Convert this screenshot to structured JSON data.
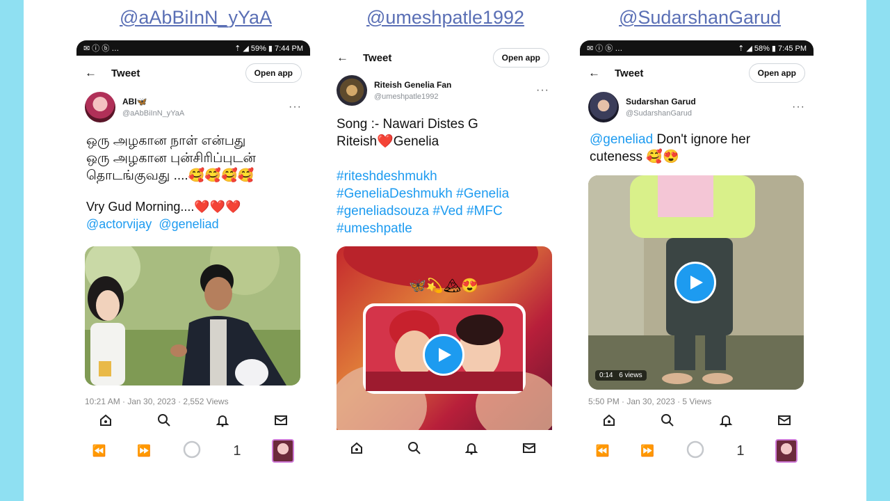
{
  "handles": [
    "@aAbBiInN_yYaA",
    "@umeshpatle1992",
    "@SudarshanGarud"
  ],
  "common": {
    "tweet_title": "Tweet",
    "open_app": "Open app",
    "back_icon": "←",
    "more_icon": "···",
    "tab_count": "1"
  },
  "phone1": {
    "status_left": "✉ ⓘ ⓑ …",
    "status_right": "⇡ ◢ 59% ▮ 7:44 PM",
    "author_name": "ABI🦋",
    "author_handle": "@aAbBiInN_yYaA",
    "line1": "ஒரு அழகான நாள் என்பது",
    "line2": "ஒரு அழகான புன்சிரிப்புடன்",
    "line3": "தொடங்குவது ....🥰🥰🥰🥰",
    "line4": " Vry Gud Morning....❤️❤️❤️",
    "mention1": "@actorvijay",
    "mention2": "@geneliad",
    "timestamp": "10:21 AM · Jan 30, 2023 · 2,552 Views"
  },
  "phone2": {
    "author_name": "Riteish Genelia Fan",
    "author_handle": "@umeshpatle1992",
    "line1": "Song :- Nawari Distes G",
    "line2": "Riteish❤️Genelia",
    "hashtags1": "#riteshdeshmukh",
    "hashtags2": "#GeneliaDeshmukh #Genelia",
    "hashtags3": "#geneliadsouza #Ved #MFC",
    "hashtags4": "#umeshpatle",
    "overlay_emojis": "🦋💫🏔😍"
  },
  "phone3": {
    "status_left": "✉ ⓘ ⓑ …",
    "status_right": "⇡ ◢ 58% ▮ 7:45 PM",
    "author_name": "Sudarshan Garud",
    "author_handle": "@SudarshanGarud",
    "mention": "@geneliad",
    "text": " Don't ignore her",
    "text2": "cuteness 🥰😍",
    "video_duration": "0:14",
    "video_views": "6 views",
    "timestamp": "5:50 PM · Jan 30, 2023 · 5 Views"
  },
  "colors": {
    "accent": "#1d9bf0",
    "handle": "#5a6fb5",
    "background": "#8fe0f2"
  }
}
